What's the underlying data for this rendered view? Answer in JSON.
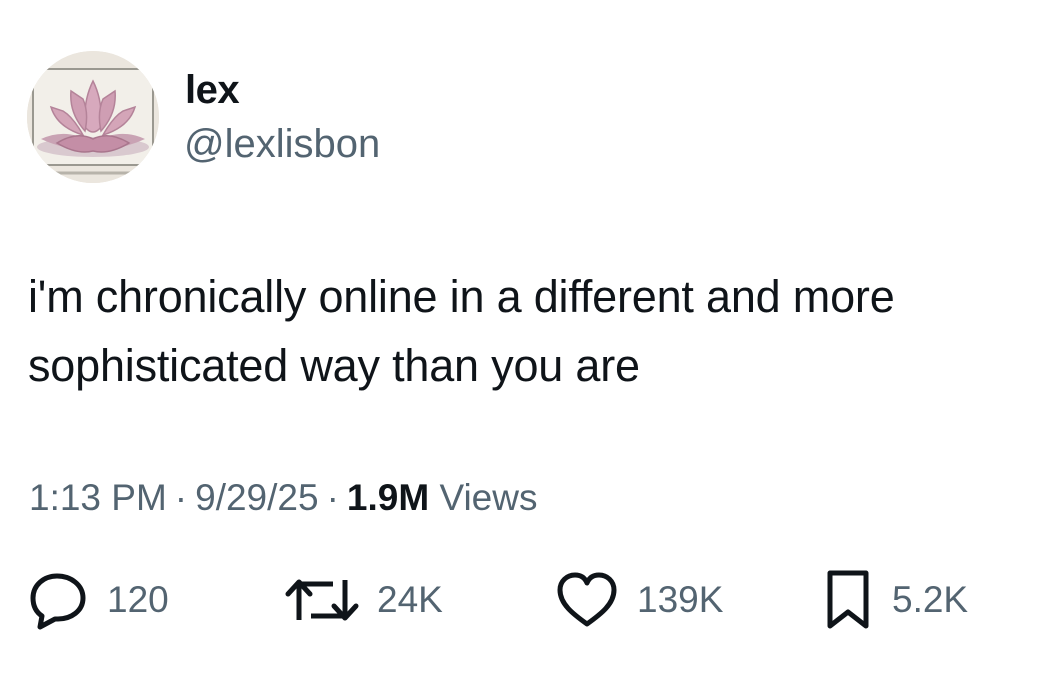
{
  "user": {
    "display_name": "lex",
    "handle": "@lexlisbon",
    "avatar_icon": "lotus-painting-avatar"
  },
  "post": {
    "text": "i'm chronically online in a different and more sophisticated way than you are",
    "time": "1:13 PM",
    "date": "9/29/25",
    "views_count": "1.9M",
    "views_label": "Views",
    "separator": "·"
  },
  "actions": {
    "replies": "120",
    "reposts": "24K",
    "likes": "139K",
    "bookmarks": "5.2K"
  },
  "colors": {
    "text": "#0f1419",
    "secondary": "#536471",
    "background": "#ffffff"
  }
}
